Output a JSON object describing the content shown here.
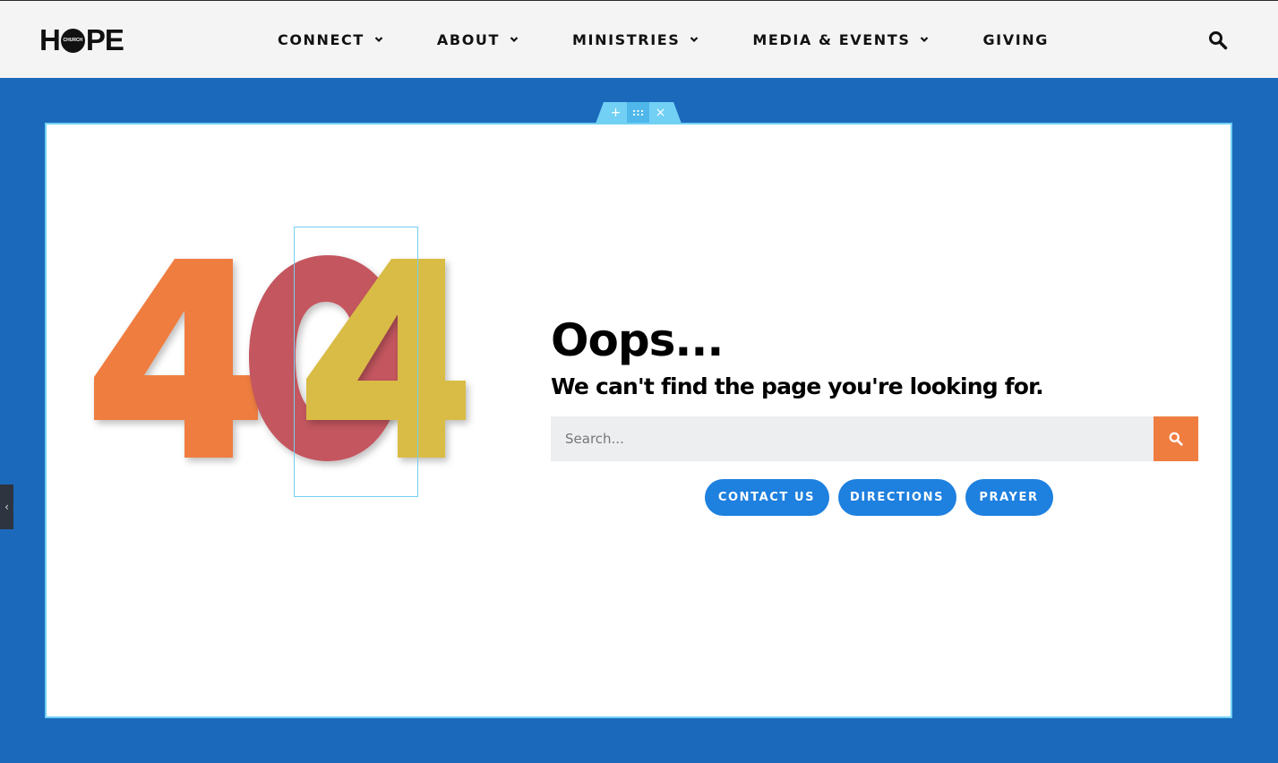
{
  "header": {
    "logo_text_left": "H",
    "logo_text_right": "PE",
    "logo_small": "CHURCH",
    "nav": [
      {
        "label": "CONNECT",
        "has_dropdown": true
      },
      {
        "label": "ABOUT",
        "has_dropdown": true
      },
      {
        "label": "MINISTRIES",
        "has_dropdown": true
      },
      {
        "label": "MEDIA & EVENTS",
        "has_dropdown": true
      },
      {
        "label": "GIVING",
        "has_dropdown": false
      }
    ],
    "search_icon": "search-icon"
  },
  "editor": {
    "add_label": "+",
    "move_label": ":::",
    "close_label": "×"
  },
  "art": {
    "digits": [
      "4",
      "0",
      "4"
    ],
    "colors": [
      "#ef7d40",
      "#c4565f",
      "#d9bc44"
    ]
  },
  "main": {
    "title": "Oops...",
    "subtitle": "We can't find the page you're looking for.",
    "search_placeholder": "Search...",
    "buttons": [
      {
        "label": "CONTACT US"
      },
      {
        "label": "DIRECTIONS"
      },
      {
        "label": "PRAYER"
      }
    ]
  },
  "panel_toggle": "‹",
  "colors": {
    "page_bg": "#1b69bb",
    "accent_orange": "#ef7d40",
    "button_blue": "#1e80df",
    "selection_outline": "#71d0f4"
  }
}
